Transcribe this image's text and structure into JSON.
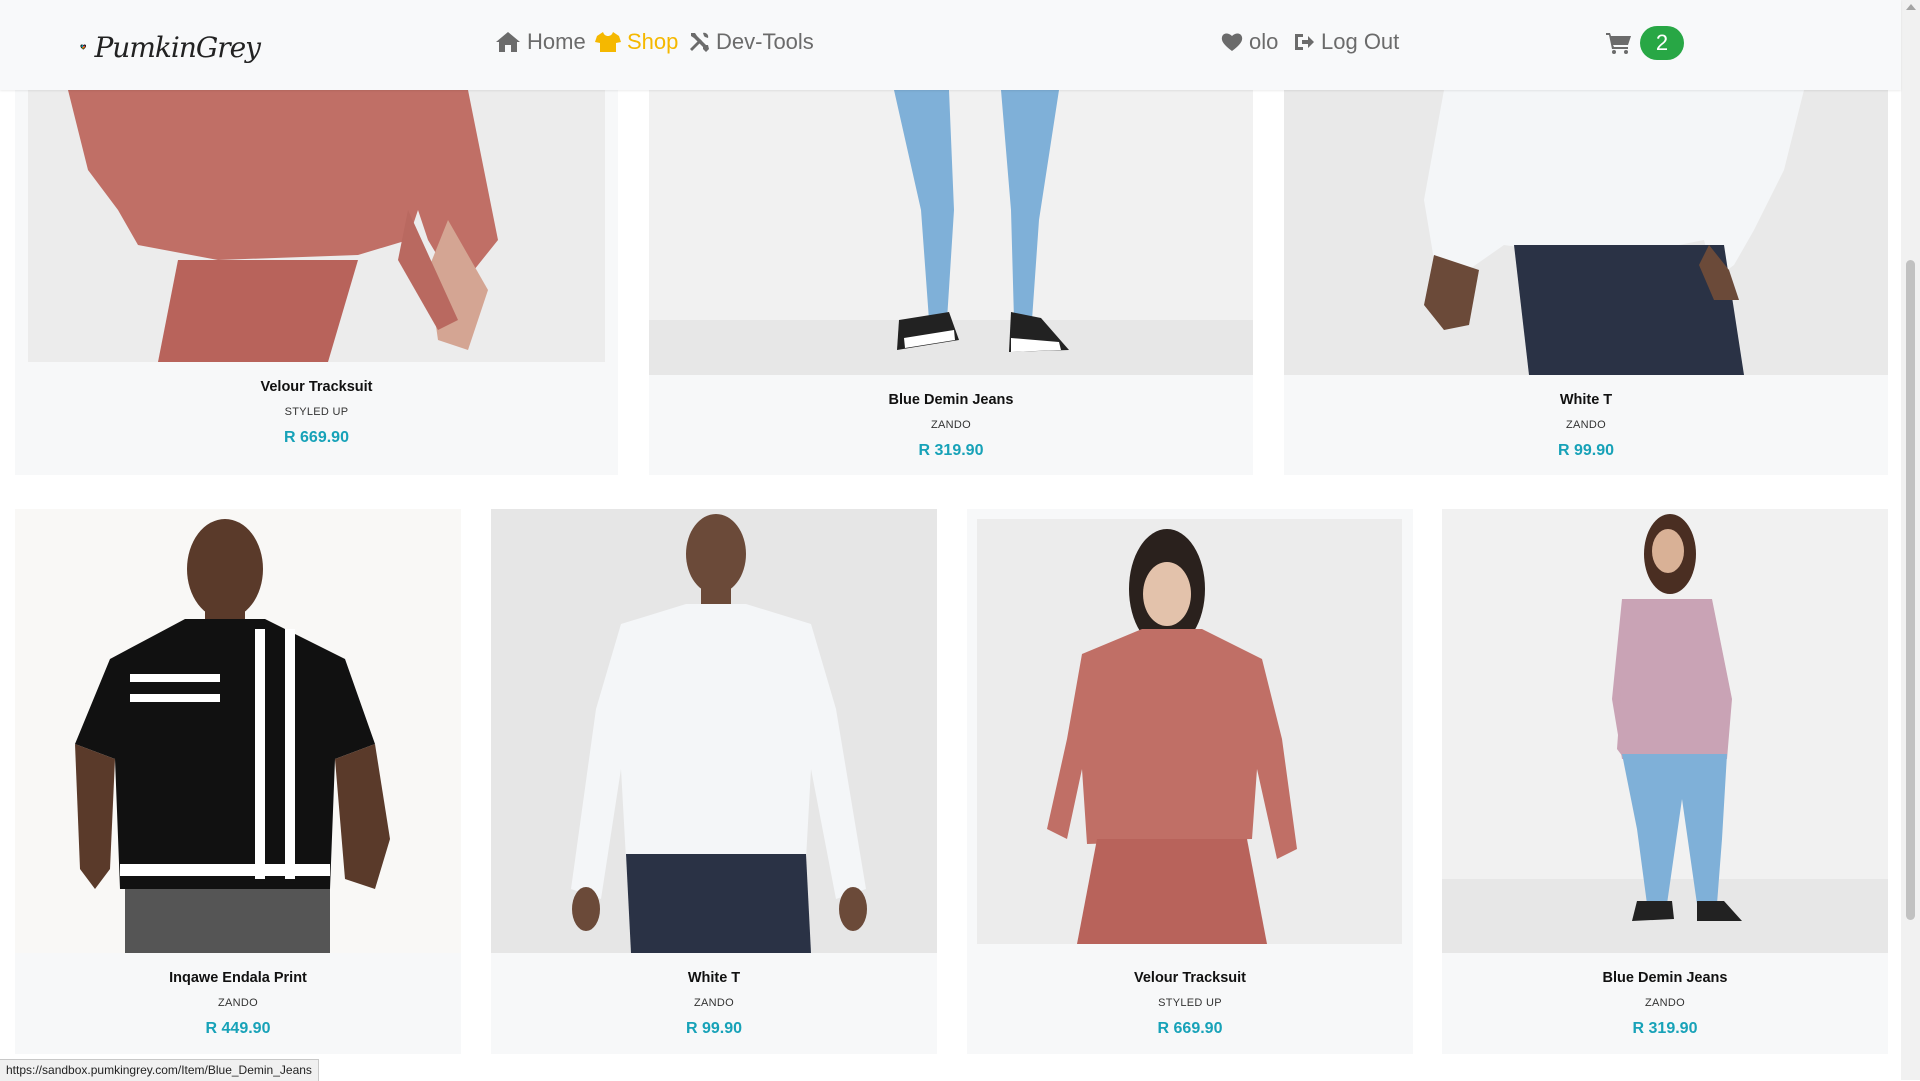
{
  "brand": {
    "name": "PumkinGrey"
  },
  "nav": {
    "home": "Home",
    "shop": "Shop",
    "devtools": "Dev-Tools",
    "user": "olo",
    "logout": "Log Out",
    "cart_count": "2"
  },
  "colors": {
    "active_nav": "#f5b800",
    "nav_text": "#6b6b6b",
    "price": "#17a2b8",
    "cart_badge": "#28a745"
  },
  "products_row1": [
    {
      "name": "Velour Tracksuit",
      "brand": "STYLED UP",
      "price": "R 669.90"
    },
    {
      "name": "Blue Demin Jeans",
      "brand": "ZANDO",
      "price": "R 319.90"
    },
    {
      "name": "White T",
      "brand": "ZANDO",
      "price": "R 99.90"
    }
  ],
  "products_row2": [
    {
      "name": "Inqawe Endala Print",
      "brand": "ZANDO",
      "price": "R 449.90"
    },
    {
      "name": "White T",
      "brand": "ZANDO",
      "price": "R 99.90"
    },
    {
      "name": "Velour Tracksuit",
      "brand": "STYLED UP",
      "price": "R 669.90"
    },
    {
      "name": "Blue Demin Jeans",
      "brand": "ZANDO",
      "price": "R 319.90"
    }
  ],
  "status_url": "https://sandbox.pumkingrey.com/Item/Blue_Demin_Jeans"
}
